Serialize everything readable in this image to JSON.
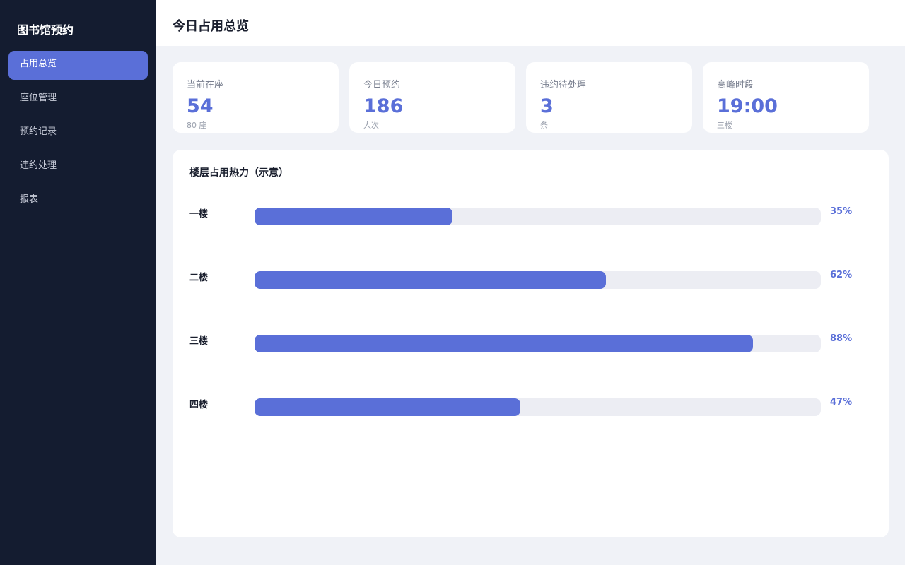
{
  "sidebar": {
    "brand": "图书馆预约",
    "items": [
      {
        "label": "占用总览",
        "active": true
      },
      {
        "label": "座位管理",
        "active": false
      },
      {
        "label": "预约记录",
        "active": false
      },
      {
        "label": "违约处理",
        "active": false
      },
      {
        "label": "报表",
        "active": false
      }
    ]
  },
  "header": {
    "title": "今日占用总览"
  },
  "stats": [
    {
      "label": "当前在座",
      "value": "54",
      "sub": "80 座"
    },
    {
      "label": "今日预约",
      "value": "186",
      "sub": "人次"
    },
    {
      "label": "违约待处理",
      "value": "3",
      "sub": "条"
    },
    {
      "label": "高峰时段",
      "value": "19:00",
      "sub": "三楼"
    }
  ],
  "heatmap": {
    "title": "楼层占用热力（示意）",
    "floors": [
      {
        "label": "一楼",
        "percent": 35,
        "percent_text": "35%"
      },
      {
        "label": "二楼",
        "percent": 62,
        "percent_text": "62%"
      },
      {
        "label": "三楼",
        "percent": 88,
        "percent_text": "88%"
      },
      {
        "label": "四楼",
        "percent": 47,
        "percent_text": "47%"
      }
    ]
  },
  "colors": {
    "sidebar_bg": "#141c30",
    "accent": "#5a6fd8",
    "track": "#ecedf3",
    "page_bg": "#f0f2f7"
  }
}
